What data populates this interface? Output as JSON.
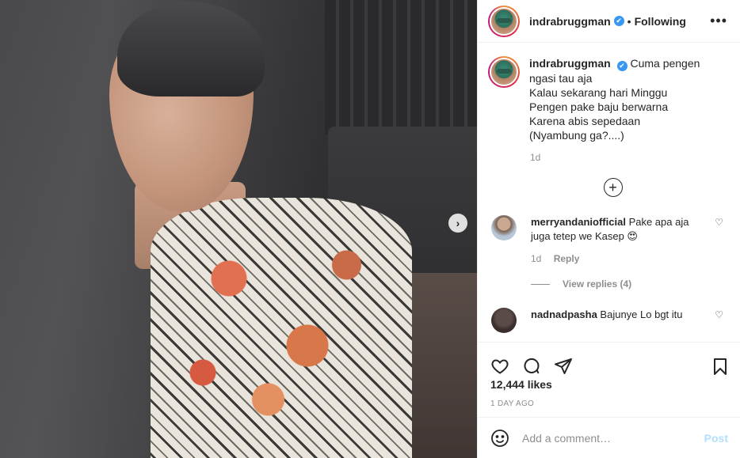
{
  "post": {
    "username": "indrabruggman",
    "follow_state": "Following",
    "caption_lines": [
      "Cuma pengen",
      "ngasi tau aja",
      "Kalau sekarang hari Minggu",
      "Pengen pake baju berwarna",
      "Karena abis sepedaan",
      "(Nyambung ga?....)"
    ],
    "caption_time": "1d",
    "likes": "12,444 likes",
    "posted_ago": "1 DAY AGO"
  },
  "comments": [
    {
      "username": "merryandaniofficial",
      "text": "Pake apa aja juga tetep we Kasep 😍",
      "time": "1d",
      "reply_label": "Reply",
      "view_replies": "View replies (4)"
    },
    {
      "username": "nadnadpasha",
      "text": "Bajunye Lo bgt itu"
    }
  ],
  "add_comment": {
    "placeholder": "Add a comment…",
    "post_label": "Post"
  },
  "icons": {
    "verified": "verified-badge-icon",
    "more": "more-options-icon",
    "load_more": "plus-circle-icon",
    "like": "heart-icon",
    "comment": "comment-bubble-icon",
    "share": "paper-plane-icon",
    "save": "bookmark-icon",
    "emoji": "emoji-smile-icon",
    "carousel_next": "chevron-right-icon"
  },
  "colors": {
    "verified_blue": "#3897f0",
    "post_button_disabled": "#b2dffc",
    "muted_text": "#8e8e8e"
  }
}
